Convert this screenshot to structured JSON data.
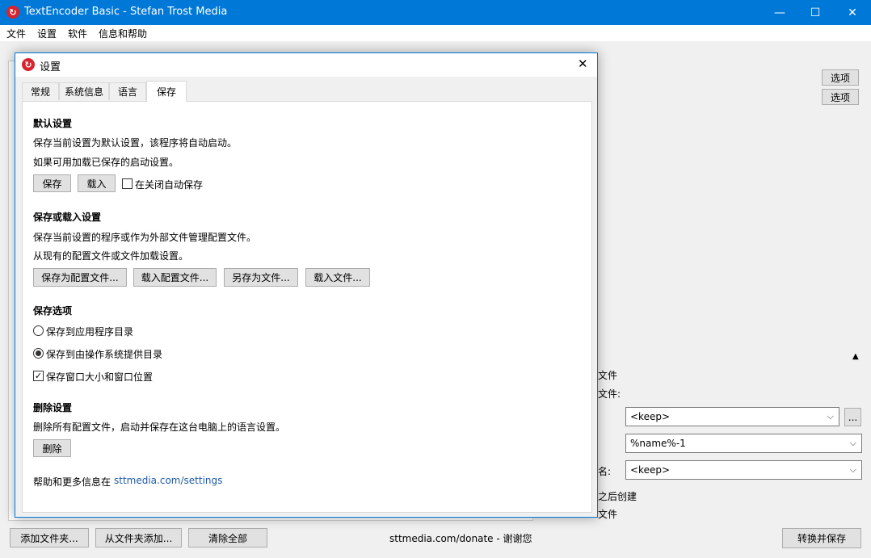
{
  "window": {
    "title": "TextEncoder Basic - Stefan Trost Media",
    "icon": "refresh-icon",
    "accent": "#0078d7"
  },
  "menu": [
    "文件",
    "设置",
    "软件",
    "信息和帮助"
  ],
  "main": {
    "option_buttons": [
      "选项",
      "选项"
    ],
    "partial_labels": {
      "files": "文件",
      "files2": "文件:",
      "name_suffix": "名:",
      "after": "之后创建",
      "file_bottom": "文件"
    },
    "combos": {
      "encoding": "<keep>",
      "name_pattern": "%name%-1",
      "ext": "<keep>"
    },
    "browse_button": "...",
    "bottom_buttons": {
      "add_file": "添加文件夹...",
      "add_from_folder": "从文件夹添加...",
      "clear_all": "清除全部",
      "convert_save": "转换并保存"
    },
    "donate_text": "sttmedia.com/donate - 谢谢您"
  },
  "dialog": {
    "title": "设置",
    "tabs": [
      "常规",
      "系统信息",
      "语言",
      "保存"
    ],
    "active_tab": 3,
    "default_section": {
      "heading": "默认设置",
      "line1": "保存当前设置为默认设置，该程序将自动启动。",
      "line2": "如果可用加载已保存的启动设置。",
      "save": "保存",
      "load": "载入",
      "autosave_label": "在关闭自动保存",
      "autosave_checked": false
    },
    "save_load_section": {
      "heading": "保存或载入设置",
      "line1": "保存当前设置的程序或作为外部文件管理配置文件。",
      "line2": "从现有的配置文件或文件加载设置。",
      "buttons": [
        "保存为配置文件...",
        "载入配置文件...",
        "另存为文件...",
        "载入文件..."
      ]
    },
    "options_section": {
      "heading": "保存选项",
      "radio1": "保存到应用程序目录",
      "radio2": "保存到由操作系统提供目录",
      "selected_radio": 2,
      "checkbox": "保存窗口大小和窗口位置",
      "checkbox_checked": true
    },
    "delete_section": {
      "heading": "删除设置",
      "line1": "删除所有配置文件，启动并保存在这台电脑上的语言设置。",
      "button": "删除"
    },
    "help_prefix": "帮助和更多信息在",
    "help_link": "sttmedia.com/settings"
  }
}
